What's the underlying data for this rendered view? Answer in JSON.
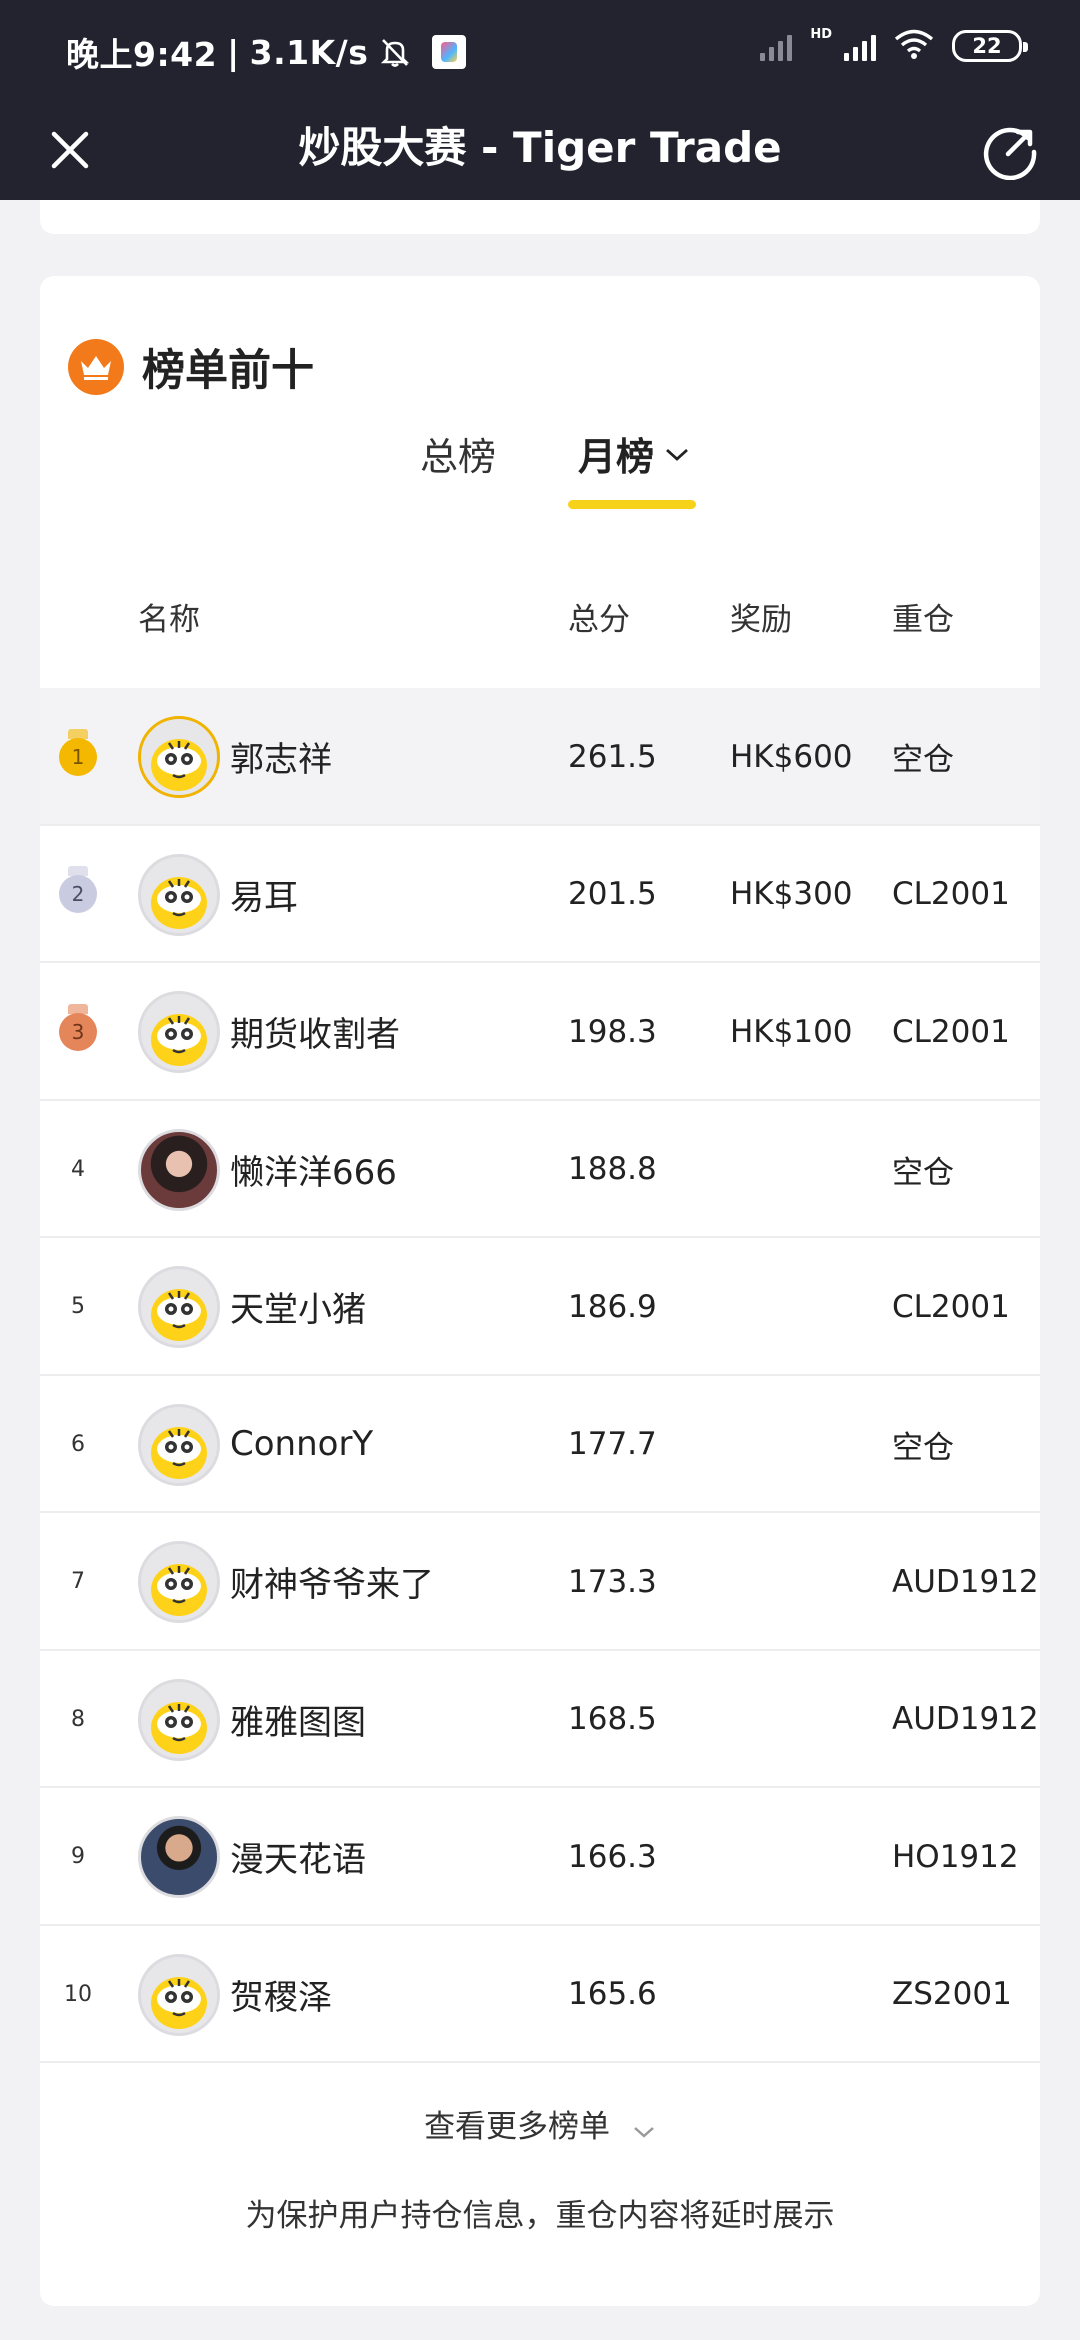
{
  "status_bar": {
    "time": "晚上9:42",
    "speed": "3.1K/s",
    "hd_label": "HD",
    "battery": "22"
  },
  "header": {
    "title": "炒股大赛 - Tiger Trade"
  },
  "leaderboard": {
    "title": "榜单前十",
    "tabs": [
      {
        "label": "总榜"
      },
      {
        "label": "月榜"
      }
    ],
    "columns": {
      "name": "名称",
      "score": "总分",
      "reward": "奖励",
      "position": "重仓"
    },
    "rows": [
      {
        "rank": "1",
        "name": "郭志祥",
        "score": "261.5",
        "reward": "HK$600",
        "position": "空仓"
      },
      {
        "rank": "2",
        "name": "易耳",
        "score": "201.5",
        "reward": "HK$300",
        "position": "CL2001"
      },
      {
        "rank": "3",
        "name": "期货收割者",
        "score": "198.3",
        "reward": "HK$100",
        "position": "CL2001"
      },
      {
        "rank": "4",
        "name": "懒洋洋666",
        "score": "188.8",
        "reward": "",
        "position": "空仓"
      },
      {
        "rank": "5",
        "name": "天堂小猪",
        "score": "186.9",
        "reward": "",
        "position": "CL2001"
      },
      {
        "rank": "6",
        "name": "ConnorY",
        "score": "177.7",
        "reward": "",
        "position": "空仓"
      },
      {
        "rank": "7",
        "name": "财神爷爷来了",
        "score": "173.3",
        "reward": "",
        "position": "AUD1912"
      },
      {
        "rank": "8",
        "name": "雅雅图图",
        "score": "168.5",
        "reward": "",
        "position": "AUD1912"
      },
      {
        "rank": "9",
        "name": "漫天花语",
        "score": "166.3",
        "reward": "",
        "position": "HO1912"
      },
      {
        "rank": "10",
        "name": "贺稷泽",
        "score": "165.6",
        "reward": "",
        "position": "ZS2001"
      }
    ],
    "more_label": "查看更多榜单",
    "note": "为保护用户持仓信息，重仓内容将延时展示"
  },
  "colors": {
    "topbar": "#23232f",
    "accent_underline": "#f6d21b",
    "crown_badge": "#f27a1a",
    "gold": "#f0b400",
    "silver": "#c9cbe0",
    "bronze": "#e5865a"
  }
}
